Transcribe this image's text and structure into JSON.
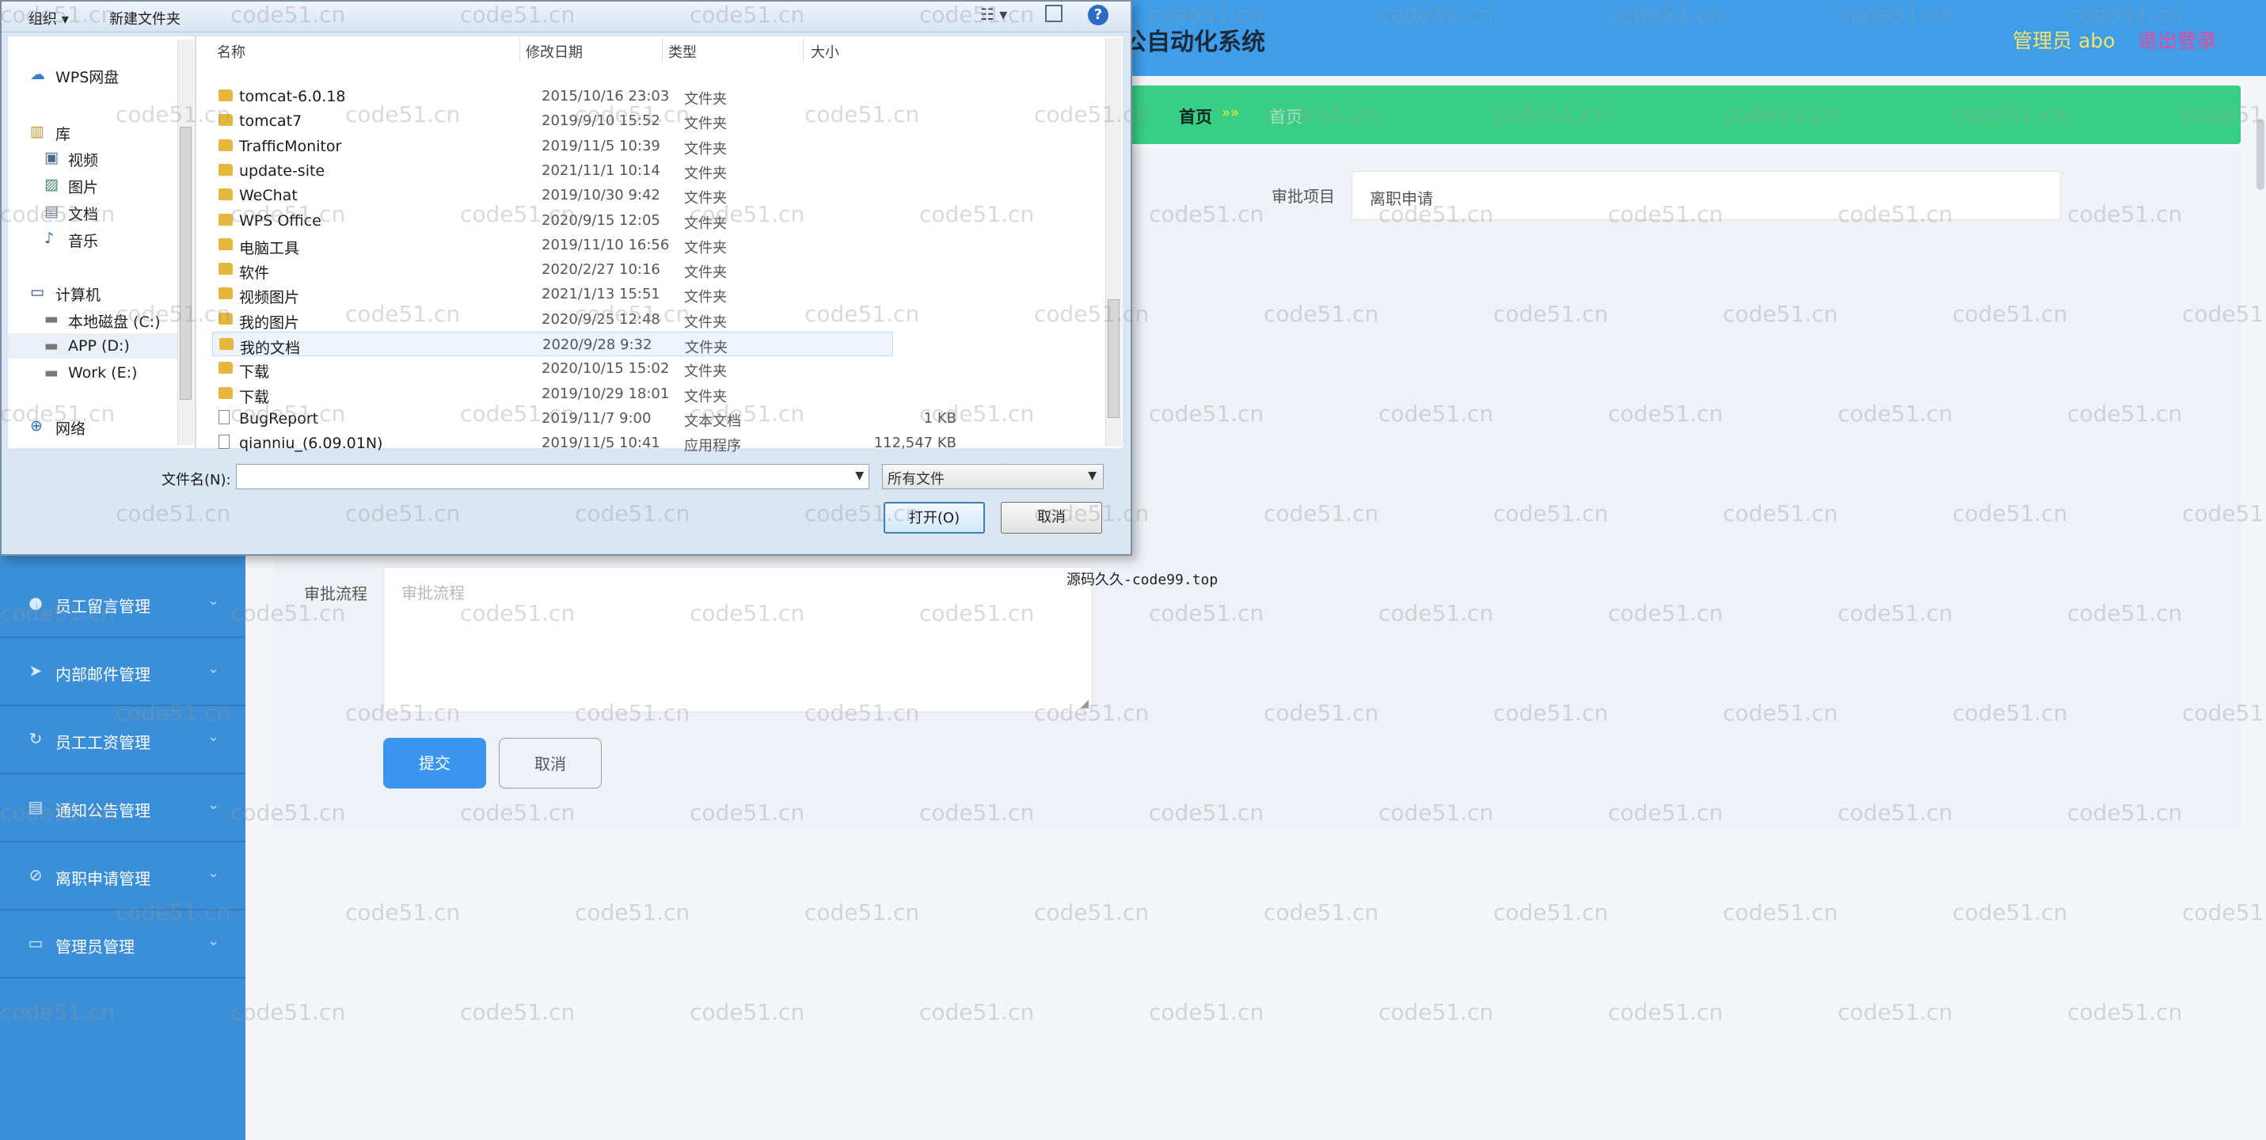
{
  "app": {
    "title": "公自动化系统",
    "admin": "管理员 abo",
    "logout": "退出登录",
    "breadcrumb": {
      "home": "首页",
      "separator": "»»",
      "current": "首页"
    }
  },
  "sidebar": {
    "items": [
      {
        "label": "员工留言管理",
        "icon": "chat-icon"
      },
      {
        "label": "内部邮件管理",
        "icon": "send-icon"
      },
      {
        "label": "员工工资管理",
        "icon": "refresh-icon"
      },
      {
        "label": "通知公告管理",
        "icon": "notice-icon"
      },
      {
        "label": "离职申请管理",
        "icon": "shield-icon"
      },
      {
        "label": "管理员管理",
        "icon": "message-icon"
      }
    ]
  },
  "form": {
    "project_label": "审批项目",
    "project_value": "离职申请",
    "flow_label": "审批流程",
    "flow_placeholder": "审批流程",
    "submit": "提交",
    "cancel": "取消"
  },
  "floating_text": "源码久久-code99.top",
  "dialog": {
    "toolbar": {
      "organize": "组织 ▾",
      "new_folder": "新建文件夹"
    },
    "nav": [
      {
        "label": "WPS网盘",
        "icon": "cloud-icon"
      },
      {
        "label": "库",
        "icon": "library-icon"
      },
      {
        "label": "视频",
        "icon": "video-icon"
      },
      {
        "label": "图片",
        "icon": "picture-icon"
      },
      {
        "label": "文档",
        "icon": "document-icon"
      },
      {
        "label": "音乐",
        "icon": "music-icon"
      },
      {
        "label": "计算机",
        "icon": "computer-icon"
      },
      {
        "label": "本地磁盘 (C:)",
        "icon": "drive-icon"
      },
      {
        "label": "APP (D:)",
        "icon": "drive-icon"
      },
      {
        "label": "Work (E:)",
        "icon": "drive-icon"
      },
      {
        "label": "网络",
        "icon": "network-icon"
      }
    ],
    "columns": {
      "name": "名称",
      "date": "修改日期",
      "type": "类型",
      "size": "大小"
    },
    "files": [
      {
        "name": "tomcat-6.0.18",
        "date": "2015/10/16 23:03",
        "type": "文件夹",
        "size": "",
        "kind": "folder"
      },
      {
        "name": "tomcat7",
        "date": "2019/9/10 15:52",
        "type": "文件夹",
        "size": "",
        "kind": "folder"
      },
      {
        "name": "TrafficMonitor",
        "date": "2019/11/5 10:39",
        "type": "文件夹",
        "size": "",
        "kind": "folder"
      },
      {
        "name": "update-site",
        "date": "2021/11/1 10:14",
        "type": "文件夹",
        "size": "",
        "kind": "folder"
      },
      {
        "name": "WeChat",
        "date": "2019/10/30 9:42",
        "type": "文件夹",
        "size": "",
        "kind": "folder"
      },
      {
        "name": "WPS Office",
        "date": "2020/9/15 12:05",
        "type": "文件夹",
        "size": "",
        "kind": "folder"
      },
      {
        "name": "电脑工具",
        "date": "2019/11/10 16:56",
        "type": "文件夹",
        "size": "",
        "kind": "folder"
      },
      {
        "name": "软件",
        "date": "2020/2/27 10:16",
        "type": "文件夹",
        "size": "",
        "kind": "folder"
      },
      {
        "name": "视频图片",
        "date": "2021/1/13 15:51",
        "type": "文件夹",
        "size": "",
        "kind": "folder"
      },
      {
        "name": "我的图片",
        "date": "2020/9/25 12:48",
        "type": "文件夹",
        "size": "",
        "kind": "folder"
      },
      {
        "name": "我的文档",
        "date": "2020/9/28 9:32",
        "type": "文件夹",
        "size": "",
        "kind": "folder"
      },
      {
        "name": "下载",
        "date": "2020/10/15 15:02",
        "type": "文件夹",
        "size": "",
        "kind": "folder"
      },
      {
        "name": "下载",
        "date": "2019/10/29 18:01",
        "type": "文件夹",
        "size": "",
        "kind": "folder"
      },
      {
        "name": "BugReport",
        "date": "2019/11/7 9:00",
        "type": "文本文档",
        "size": "1 KB",
        "kind": "doc"
      },
      {
        "name": "qianniu_(6.09.01N)",
        "date": "2019/11/5 10:41",
        "type": "应用程序",
        "size": "112,547 KB",
        "kind": "doc"
      }
    ],
    "filename_label": "文件名(N):",
    "filename_value": "",
    "filter": "所有文件",
    "open": "打开(O)",
    "cancel": "取消"
  },
  "watermark": "code51.cn"
}
